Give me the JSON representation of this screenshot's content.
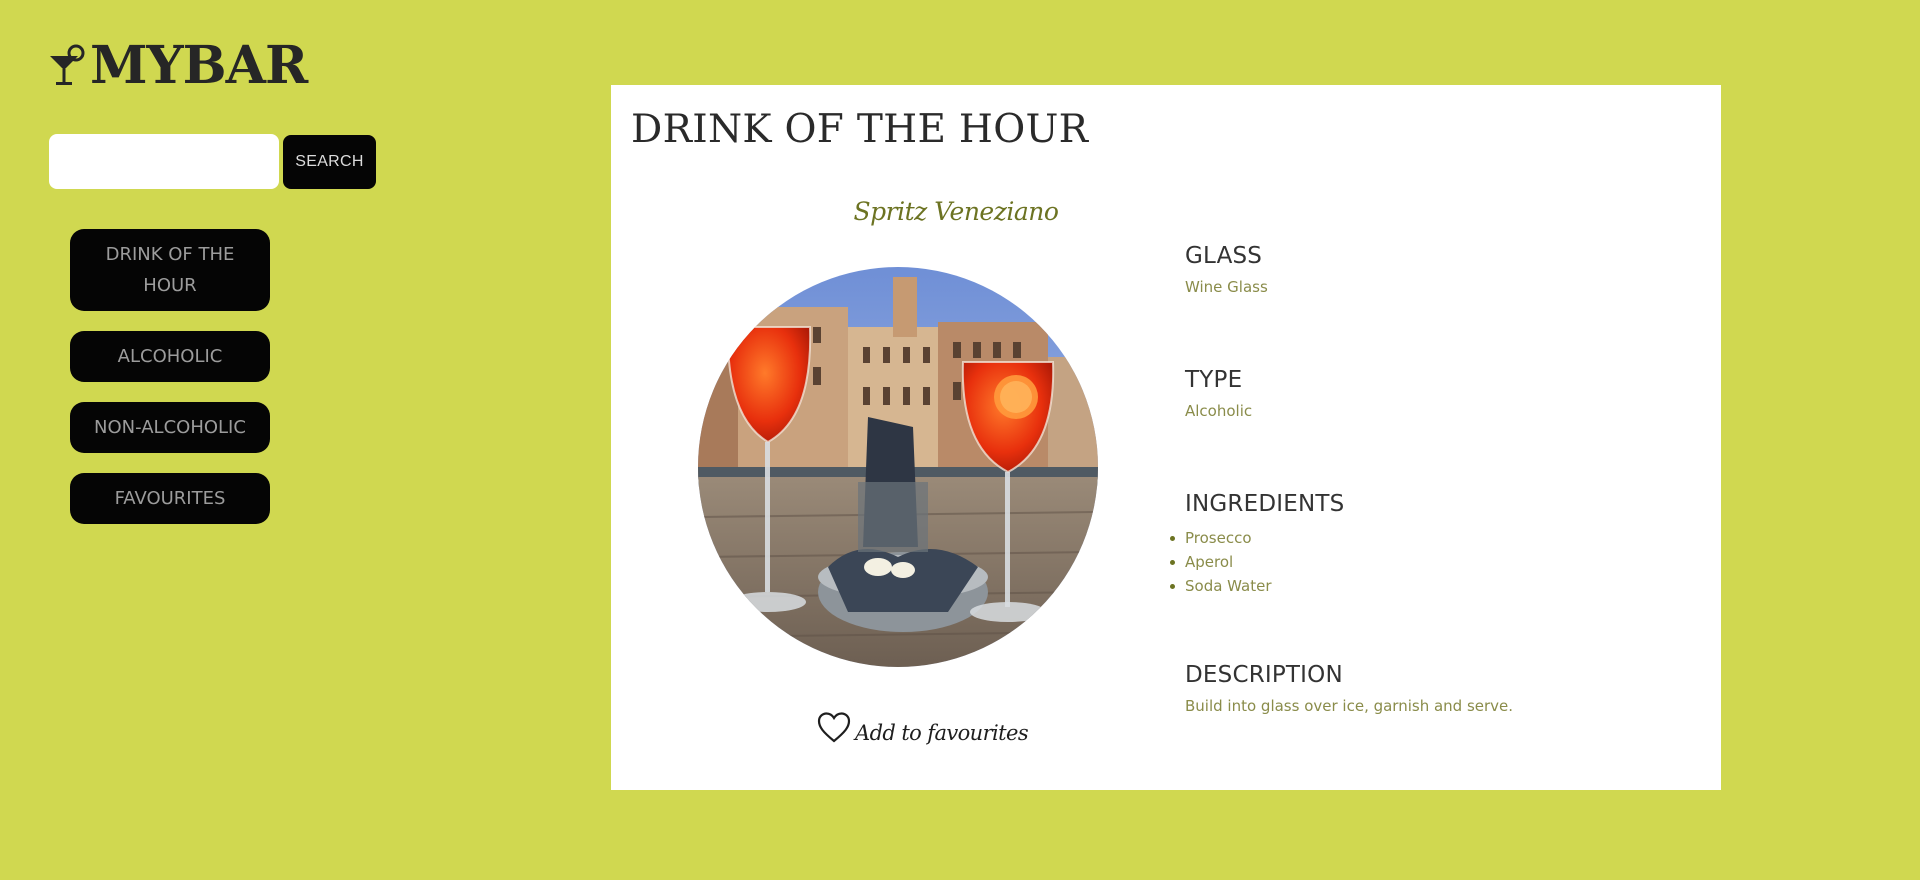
{
  "header": {
    "brand": "MYBAR"
  },
  "search": {
    "placeholder": "",
    "value": "",
    "button_label": "SEARCH"
  },
  "sidebar": {
    "items": [
      {
        "label": "DRINK OF THE HOUR"
      },
      {
        "label": "ALCOHOLIC"
      },
      {
        "label": "NON-ALCOHOLIC"
      },
      {
        "label": "FAVOURITES"
      }
    ]
  },
  "main": {
    "title": "DRINK OF THE HOUR",
    "drink_name": "Spritz Veneziano",
    "favourite_label": "Add to favourites",
    "sections": {
      "glass": {
        "heading": "GLASS",
        "value": "Wine Glass"
      },
      "type": {
        "heading": "TYPE",
        "value": "Alcoholic"
      },
      "ingredients": {
        "heading": "INGREDIENTS",
        "items": [
          "Prosecco",
          "Aperol",
          "Soda Water"
        ]
      },
      "description": {
        "heading": "DESCRIPTION",
        "value": "Build into glass over ice, garnish and serve."
      }
    }
  },
  "icons": {
    "logo": "cocktail-glass-icon",
    "favourite": "heart-outline-icon"
  },
  "colors": {
    "background": "#d0d850",
    "nav_button": "#050505",
    "nav_text": "#9c9c9c",
    "accent_text": "#6c7322",
    "muted_text": "#8a8c4a"
  }
}
